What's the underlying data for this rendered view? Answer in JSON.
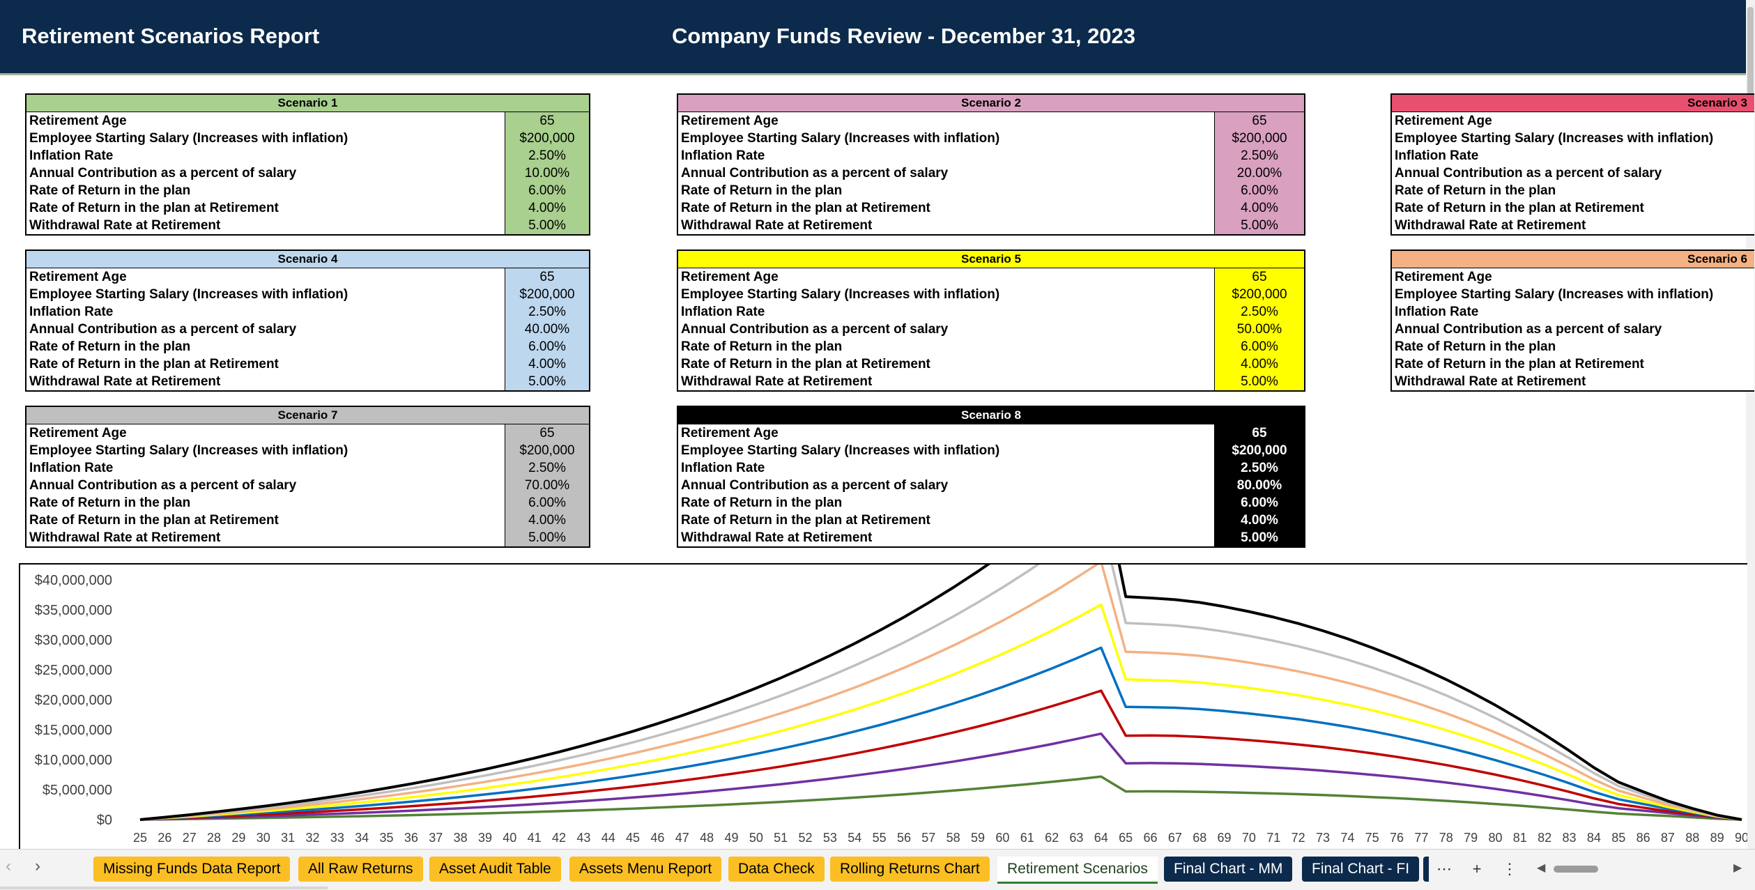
{
  "header": {
    "left_title": "Retirement Scenarios Report",
    "center_title": "Company Funds Review - December 31, 2023"
  },
  "row_labels": [
    "Retirement Age",
    "Employee Starting Salary (Increases with inflation)",
    "Inflation Rate",
    "Annual Contribution as a percent of salary",
    "Rate of Return in the plan",
    "Rate of Return in the plan at Retirement",
    "Withdrawal Rate at Retirement"
  ],
  "scenarios": [
    {
      "title": "Scenario 1",
      "color": "#a9d08e",
      "values": [
        "65",
        "$200,000",
        "2.50%",
        "10.00%",
        "6.00%",
        "4.00%",
        "5.00%"
      ]
    },
    {
      "title": "Scenario 2",
      "color": "#d9a0c0",
      "values": [
        "65",
        "$200,000",
        "2.50%",
        "20.00%",
        "6.00%",
        "4.00%",
        "5.00%"
      ]
    },
    {
      "title": "Scenario 3",
      "color": "#e8506f",
      "values": []
    },
    {
      "title": "Scenario 4",
      "color": "#bdd7ee",
      "values": [
        "65",
        "$200,000",
        "2.50%",
        "40.00%",
        "6.00%",
        "4.00%",
        "5.00%"
      ]
    },
    {
      "title": "Scenario 5",
      "color": "#ffff00",
      "values": [
        "65",
        "$200,000",
        "2.50%",
        "50.00%",
        "6.00%",
        "4.00%",
        "5.00%"
      ]
    },
    {
      "title": "Scenario 6",
      "color": "#f4b183",
      "values": []
    },
    {
      "title": "Scenario 7",
      "color": "#bfbfbf",
      "values": [
        "65",
        "$200,000",
        "2.50%",
        "70.00%",
        "6.00%",
        "4.00%",
        "5.00%"
      ]
    },
    {
      "title": "Scenario 8",
      "color": "#000000",
      "values": [
        "65",
        "$200,000",
        "2.50%",
        "80.00%",
        "6.00%",
        "4.00%",
        "5.00%"
      ]
    }
  ],
  "chart_data": {
    "type": "line",
    "title": "",
    "xlabel": "",
    "ylabel": "",
    "ylim": [
      0,
      40000000
    ],
    "y_ticks": [
      "$0",
      "$5,000,000",
      "$10,000,000",
      "$15,000,000",
      "$20,000,000",
      "$25,000,000",
      "$30,000,000",
      "$35,000,000",
      "$40,000,000"
    ],
    "x": [
      25,
      26,
      27,
      28,
      29,
      30,
      31,
      32,
      33,
      34,
      35,
      36,
      37,
      38,
      39,
      40,
      41,
      42,
      43,
      44,
      45,
      46,
      47,
      48,
      49,
      50,
      51,
      52,
      53,
      54,
      55,
      56,
      57,
      58,
      59,
      60,
      61,
      62,
      63,
      64,
      65,
      66,
      67,
      68,
      69,
      70,
      71,
      72,
      73,
      74,
      75,
      76,
      77,
      78,
      79,
      80,
      81,
      82,
      83,
      84,
      85,
      86,
      87,
      88,
      89,
      90
    ],
    "grid": false,
    "legend": "none",
    "series": [
      {
        "color": "#548235",
        "values": [
          0,
          49000,
          101000,
          157000,
          216000,
          278000,
          345000,
          416000,
          491000,
          571000,
          656000,
          746000,
          842000,
          943000,
          1050000,
          1164000,
          1284000,
          1412000,
          1547000,
          1690000,
          1841000,
          2001000,
          2171000,
          2351000,
          2541000,
          2742000,
          2955000,
          3181000,
          3420000,
          3673000,
          3940000,
          4223000,
          4523000,
          4840000,
          5176000,
          5531000,
          5907000,
          6305000,
          6726000,
          7171000,
          4700000,
          4720000,
          4700000,
          4640000,
          4560000,
          4470000,
          4360000,
          4240000,
          4100000,
          3940000,
          3760000,
          3570000,
          3360000,
          3130000,
          2880000,
          2610000,
          2320000,
          2010000,
          1680000,
          1330000,
          1000000,
          800000,
          600000,
          380000,
          150000,
          0
        ]
      },
      {
        "color": "#7030a0",
        "values": [
          0,
          98000,
          202000,
          314000,
          432000,
          556000,
          690000,
          832000,
          982000,
          1142000,
          1312000,
          1492000,
          1684000,
          1886000,
          2100000,
          2328000,
          2568000,
          2824000,
          3094000,
          3380000,
          3682000,
          4002000,
          4342000,
          4702000,
          5082000,
          5484000,
          5910000,
          6362000,
          6840000,
          7346000,
          7880000,
          8446000,
          9046000,
          9680000,
          10352000,
          11062000,
          11814000,
          12610000,
          13452000,
          14342000,
          9400000,
          9430000,
          9400000,
          9290000,
          9120000,
          8920000,
          8700000,
          8450000,
          8160000,
          7840000,
          7480000,
          7090000,
          6660000,
          6190000,
          5680000,
          5130000,
          4540000,
          3900000,
          3220000,
          2500000,
          1900000,
          1500000,
          1100000,
          700000,
          300000,
          0
        ]
      },
      {
        "color": "#c00000",
        "values": [
          0,
          147000,
          303000,
          471000,
          648000,
          834000,
          1035000,
          1248000,
          1473000,
          1713000,
          1968000,
          2238000,
          2526000,
          2829000,
          3150000,
          3492000,
          3852000,
          4236000,
          4641000,
          5070000,
          5523000,
          6003000,
          6513000,
          7053000,
          7623000,
          8226000,
          8865000,
          9543000,
          10260000,
          11019000,
          11820000,
          12669000,
          13569000,
          14520000,
          15528000,
          16593000,
          17721000,
          18915000,
          20178000,
          21513000,
          14000000,
          14040000,
          13980000,
          13810000,
          13560000,
          13260000,
          12920000,
          12540000,
          12100000,
          11610000,
          11060000,
          10460000,
          9810000,
          9100000,
          8330000,
          7500000,
          6610000,
          5650000,
          4630000,
          3550000,
          2600000,
          2000000,
          1400000,
          900000,
          380000,
          0
        ]
      },
      {
        "color": "#0070c0",
        "values": [
          0,
          196000,
          404000,
          628000,
          864000,
          1112000,
          1380000,
          1664000,
          1964000,
          2284000,
          2624000,
          2984000,
          3368000,
          3772000,
          4200000,
          4656000,
          5136000,
          5648000,
          6188000,
          6760000,
          7364000,
          8004000,
          8684000,
          9404000,
          10164000,
          10968000,
          11820000,
          12724000,
          13680000,
          14692000,
          15760000,
          16892000,
          18092000,
          19360000,
          20704000,
          22124000,
          23628000,
          25220000,
          26904000,
          28684000,
          18800000,
          18760000,
          18660000,
          18440000,
          18100000,
          17700000,
          17250000,
          16740000,
          16140000,
          15480000,
          14740000,
          13930000,
          13050000,
          12090000,
          11050000,
          9920000,
          8720000,
          7440000,
          6070000,
          4620000,
          3400000,
          2600000,
          1800000,
          1100000,
          450000,
          0
        ]
      },
      {
        "color": "#ffff00",
        "values": [
          0,
          245000,
          505000,
          785000,
          1080000,
          1390000,
          1725000,
          2080000,
          2455000,
          2855000,
          3280000,
          3730000,
          4210000,
          4715000,
          5250000,
          5820000,
          6420000,
          7060000,
          7735000,
          8450000,
          9205000,
          10005000,
          10855000,
          11755000,
          12705000,
          13710000,
          14775000,
          15905000,
          17100000,
          18365000,
          19700000,
          21115000,
          22615000,
          24200000,
          25880000,
          27655000,
          29535000,
          31525000,
          33630000,
          35855000,
          23400000,
          23280000,
          23140000,
          22870000,
          22450000,
          21960000,
          21390000,
          20750000,
          20000000,
          19170000,
          18240000,
          17230000,
          16130000,
          14940000,
          13640000,
          12240000,
          10740000,
          9150000,
          7450000,
          5650000,
          4100000,
          3100000,
          2100000,
          1300000,
          520000,
          0
        ]
      },
      {
        "color": "#f4b183",
        "values": [
          0,
          294000,
          606000,
          942000,
          1296000,
          1668000,
          2070000,
          2496000,
          2946000,
          3426000,
          3936000,
          4476000,
          5052000,
          5658000,
          6300000,
          6984000,
          7704000,
          8472000,
          9282000,
          10140000,
          11046000,
          12006000,
          13026000,
          14106000,
          15246000,
          16452000,
          17730000,
          19086000,
          20520000,
          22038000,
          23640000,
          25338000,
          27138000,
          29040000,
          31056000,
          33186000,
          35442000,
          37830000,
          40356000,
          43026000,
          28000000,
          27860000,
          27660000,
          27320000,
          26810000,
          26200000,
          25510000,
          24730000,
          23830000,
          22830000,
          21720000,
          20510000,
          19190000,
          17760000,
          16210000,
          14540000,
          12750000,
          10850000,
          8830000,
          6690000,
          4850000,
          3650000,
          2450000,
          1500000,
          600000,
          0
        ]
      },
      {
        "color": "#bfbfbf",
        "values": [
          0,
          343000,
          707000,
          1099000,
          1512000,
          1946000,
          2415000,
          2912000,
          3437000,
          3997000,
          4592000,
          5222000,
          5894000,
          6601000,
          7350000,
          8148000,
          8988000,
          9884000,
          10829000,
          11830000,
          12887000,
          14007000,
          15197000,
          16457000,
          17787000,
          19194000,
          20685000,
          22267000,
          23940000,
          25711000,
          27580000,
          29561000,
          31661000,
          33880000,
          36232000,
          38717000,
          41349000,
          44135000,
          47082000,
          50197000,
          32800000,
          32620000,
          32380000,
          31970000,
          31370000,
          30650000,
          29840000,
          28920000,
          27860000,
          26690000,
          25380000,
          23960000,
          22410000,
          20730000,
          18910000,
          16950000,
          14850000,
          12620000,
          10260000,
          7760000,
          5600000,
          4200000,
          2800000,
          1700000,
          680000,
          0
        ]
      },
      {
        "color": "#000000",
        "values": [
          0,
          392000,
          808000,
          1256000,
          1728000,
          2224000,
          2760000,
          3328000,
          3928000,
          4568000,
          5248000,
          5968000,
          6736000,
          7544000,
          8400000,
          9312000,
          10272000,
          11296000,
          12376000,
          13520000,
          14728000,
          16008000,
          17368000,
          18808000,
          20328000,
          21936000,
          23640000,
          25448000,
          27360000,
          29384000,
          31520000,
          33784000,
          36184000,
          38720000,
          41408000,
          44248000,
          47256000,
          50440000,
          53808000,
          57368000,
          37200000,
          36980000,
          36700000,
          36230000,
          35540000,
          34710000,
          33780000,
          32720000,
          31510000,
          30170000,
          28680000,
          27050000,
          25290000,
          23380000,
          21310000,
          19090000,
          16710000,
          14180000,
          11500000,
          8670000,
          6250000,
          4650000,
          3100000,
          1850000,
          750000,
          0
        ]
      }
    ]
  },
  "tabs": [
    {
      "label": "Missing Funds Data Report"
    },
    {
      "label": "All Raw Returns"
    },
    {
      "label": "Asset Audit Table"
    },
    {
      "label": "Assets Menu Report"
    },
    {
      "label": "Data Check"
    },
    {
      "label": "Rolling Returns Chart"
    },
    {
      "label": "Retirement Scenarios"
    },
    {
      "label": "Final Chart - MM"
    },
    {
      "label": "Final Chart - FI"
    }
  ],
  "tabbar": {
    "prev_icon": "‹",
    "next_icon": "›",
    "more_icon": "⋯",
    "add_icon": "+",
    "options_icon": "⋮",
    "scroll_left_icon": "◀",
    "scroll_right_icon": "▶"
  }
}
